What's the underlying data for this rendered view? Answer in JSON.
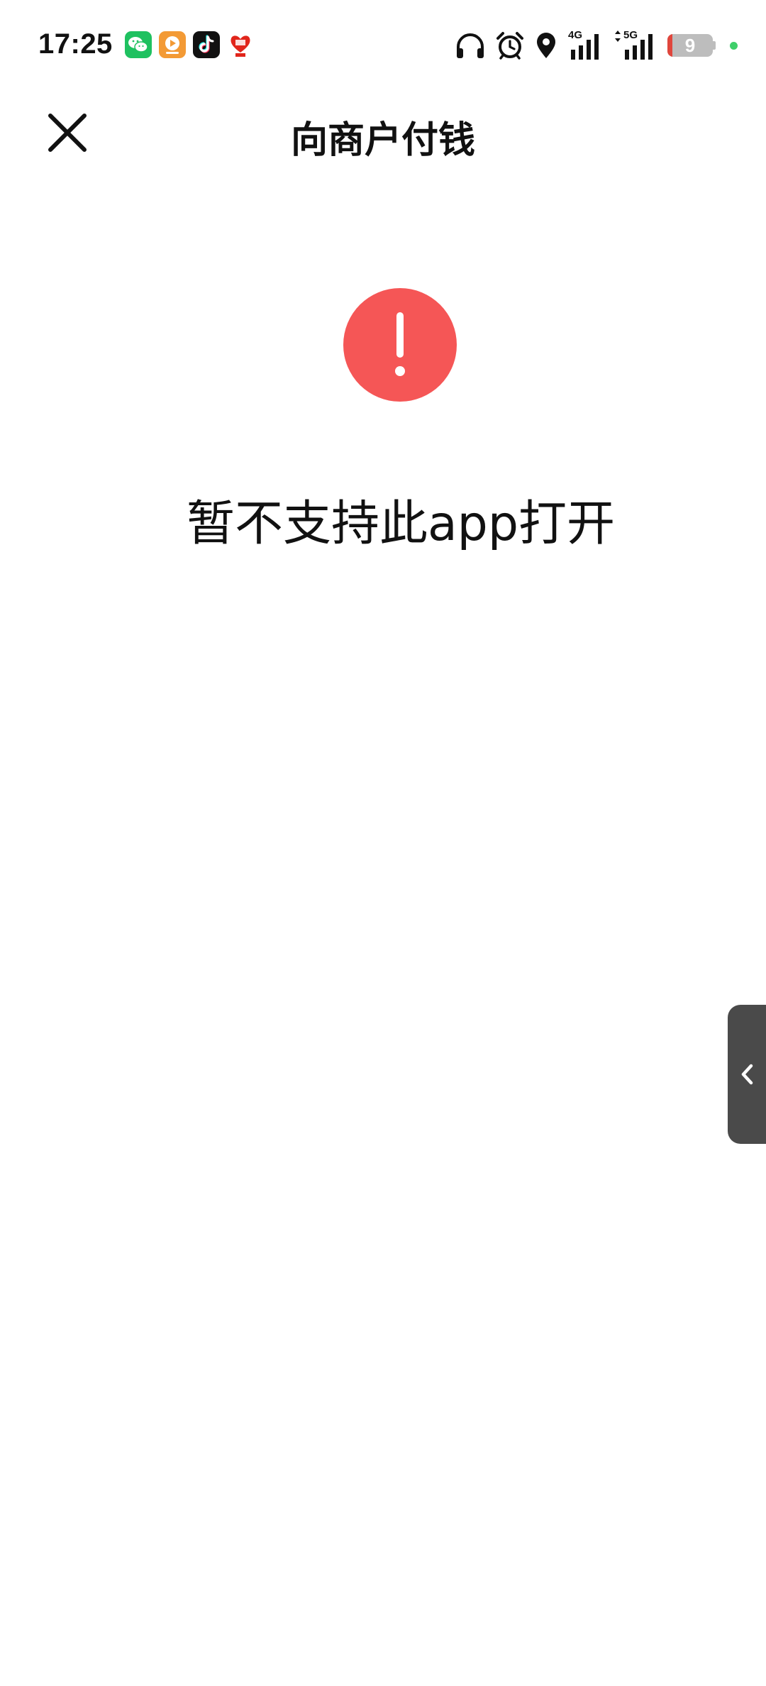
{
  "status_bar": {
    "time": "17:25",
    "notification_icons": [
      "wechat-icon",
      "video-app-icon",
      "tiktok-icon",
      "shopping-618-icon"
    ],
    "system_icons": [
      "headphones-icon",
      "alarm-icon",
      "location-icon",
      "signal-4g-icon",
      "signal-5g-icon",
      "battery-icon"
    ],
    "network_1": "4G",
    "network_2": "5G",
    "battery_level": "9",
    "colors": {
      "battery_body": "#bdbdbd",
      "battery_low": "#e0463c",
      "dot": "#3fcf6a"
    }
  },
  "header": {
    "title": "向商户付钱",
    "close_icon": "close-icon"
  },
  "main": {
    "alert_icon": "exclamation-icon",
    "alert_color": "#f55656",
    "message": "暂不支持此app打开"
  },
  "side_handle": {
    "icon": "chevron-left-icon"
  }
}
